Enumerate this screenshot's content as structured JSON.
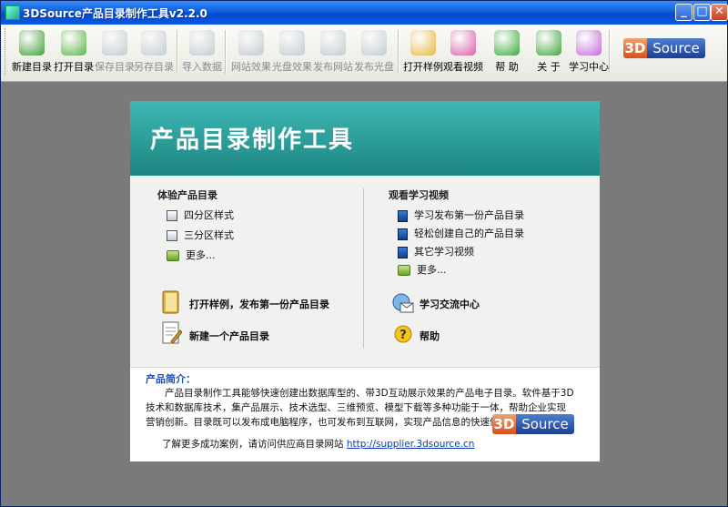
{
  "window": {
    "title": "3DSource产品目录制作工具v2.2.0",
    "controls": {
      "minimize": "_",
      "maximize": "□",
      "close": "✕"
    }
  },
  "toolbar": {
    "buttons": [
      {
        "label": "新建目录",
        "icon": "new-catalog-icon",
        "color": "#3f9e3a",
        "enabled": true
      },
      {
        "label": "打开目录",
        "icon": "open-catalog-icon",
        "color": "#5ab34a",
        "enabled": true
      },
      {
        "label": "保存目录",
        "icon": "save-catalog-icon",
        "color": "#8aa0b8",
        "enabled": false
      },
      {
        "label": "另存目录",
        "icon": "save-as-catalog-icon",
        "color": "#8aa0b8",
        "enabled": false
      },
      {
        "label": "导入数据",
        "icon": "import-data-icon",
        "color": "#8aa0b8",
        "enabled": false
      },
      {
        "label": "网站效果",
        "icon": "website-preview-icon",
        "color": "#8aa0b8",
        "enabled": false
      },
      {
        "label": "光盘效果",
        "icon": "cd-preview-icon",
        "color": "#8aa0b8",
        "enabled": false
      },
      {
        "label": "发布网站",
        "icon": "publish-website-icon",
        "color": "#8aa0b8",
        "enabled": false
      },
      {
        "label": "发布光盘",
        "icon": "publish-cd-icon",
        "color": "#8aa0b8",
        "enabled": false
      },
      {
        "label": "打开样例",
        "icon": "open-sample-icon",
        "color": "#e6b840",
        "enabled": true
      },
      {
        "label": "观看视频",
        "icon": "watch-video-icon",
        "color": "#d85fa8",
        "enabled": true
      },
      {
        "label": "帮 助",
        "icon": "help-icon",
        "color": "#3aa83a",
        "enabled": true
      },
      {
        "label": "关 于",
        "icon": "about-icon",
        "color": "#3fa33f",
        "enabled": true
      },
      {
        "label": "学习中心",
        "icon": "learning-center-icon",
        "color": "#c46ad6",
        "enabled": true
      }
    ],
    "logo": {
      "a": "3D",
      "b": "Source"
    }
  },
  "panel": {
    "title": "产品目录制作工具",
    "left": {
      "heading": "体验产品目录",
      "items": [
        "四分区样式",
        "三分区样式",
        "更多..."
      ],
      "actions": [
        "打开样例，发布第一份产品目录",
        "新建一个产品目录"
      ]
    },
    "right": {
      "heading": "观看学习视频",
      "items": [
        "学习发布第一份产品目录",
        "轻松创建自己的产品目录",
        "其它学习视频",
        "更多..."
      ],
      "actions": [
        "学习交流中心",
        "帮助"
      ]
    },
    "intro": {
      "title": "产品简介：",
      "body": "产品目录制作工具能够快速创建出数据库型的、带3D互动展示效果的产品电子目录。软件基于3D技术和数据库技术，集产品展示、技术选型、三维预览、模型下载等多种功能于一体，帮助企业实现营销创新。目录既可以发布成电脑程序，也可发布到互联网，实现产品信息的快速传播。",
      "more_prefix": "了解更多成功案例，请访问供应商目录网站 ",
      "link": "http://supplier.3dsource.cn"
    }
  }
}
